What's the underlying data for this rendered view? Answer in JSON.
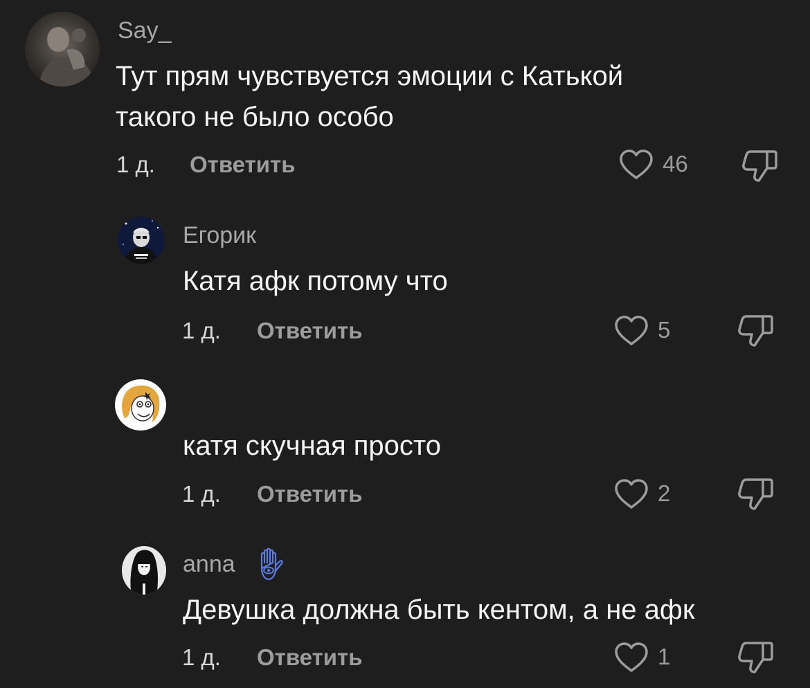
{
  "comments": [
    {
      "username": "Say_",
      "text_lines": [
        "Тут прям чувствуется эмоции с Катькой",
        "такого не было особо"
      ],
      "time": "1 д.",
      "reply_label": "Ответить",
      "likes": "46",
      "avatar_icon": "user-avatar-photo"
    },
    {
      "username": "Егорик",
      "text_lines": [
        "Катя афк потому что"
      ],
      "time": "1 д.",
      "reply_label": "Ответить",
      "likes": "5",
      "avatar_icon": "user-avatar-photo"
    },
    {
      "username": "",
      "text_lines": [
        "катя скучная просто"
      ],
      "time": "1 д.",
      "reply_label": "Ответить",
      "likes": "2",
      "avatar_icon": "meme-face-avatar"
    },
    {
      "username": "anna",
      "username_badge": "hamsa-hand-icon",
      "text_lines": [
        "Девушка должна быть кентом, а не афк"
      ],
      "time": "1 д.",
      "reply_label": "Ответить",
      "likes": "1",
      "avatar_icon": "user-avatar-drawing"
    }
  ],
  "colors": {
    "background": "#1e1e1e",
    "text": "#f5f5f5",
    "muted": "#9c9c9c",
    "username": "#a7a7a7"
  }
}
